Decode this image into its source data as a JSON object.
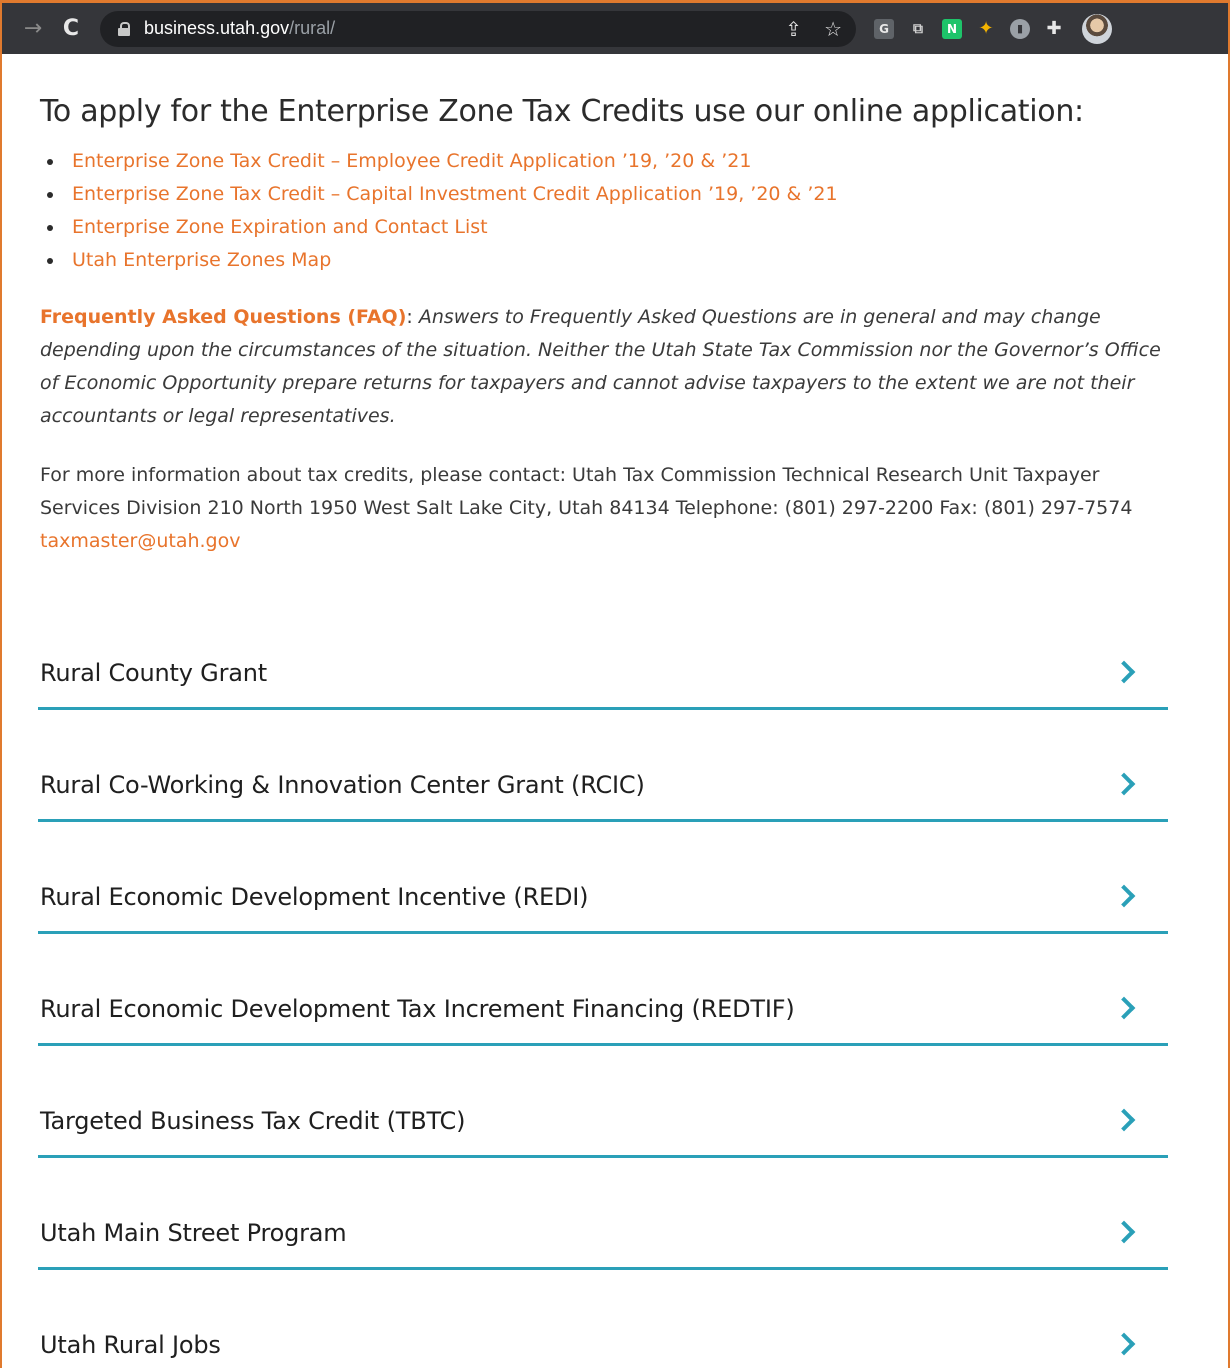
{
  "browser": {
    "url_host": "business.utah.gov",
    "url_path": "/rural/"
  },
  "page": {
    "apply_title": "To apply for the Enterprise Zone Tax Credits use our online application:",
    "links": [
      {
        "label": "Enterprise Zone Tax Credit – Employee Credit Application ’19, ’20 & ’21"
      },
      {
        "label": "Enterprise Zone Tax Credit – Capital Investment Credit Application ’19, ’20 & ’21"
      },
      {
        "label": "Enterprise Zone Expiration and Contact List"
      },
      {
        "label": "Utah Enterprise Zones Map"
      }
    ],
    "faq": {
      "label": "Frequently Asked Questions (FAQ)",
      "separator": ": ",
      "text": "Answers to Frequently Asked Questions are in general and may change depending upon the circumstances of the situation. Neither the Utah State Tax Commission nor the Governor’s Office of Economic Opportunity prepare returns for taxpayers and cannot advise taxpayers to the extent we are not their accountants or legal representatives."
    },
    "contact": {
      "text": "For more information about tax credits, please contact: Utah Tax Commission Technical Research Unit Taxpayer Services Division 210 North 1950 West Salt Lake City, Utah 84134 Telephone: (801) 297-2200 Fax: (801) 297-7574 ",
      "email": "taxmaster@utah.gov"
    },
    "accordion": [
      {
        "label": "Rural County Grant"
      },
      {
        "label": "Rural Co-Working & Innovation Center Grant (RCIC)"
      },
      {
        "label": "Rural Economic Development Incentive (REDI)"
      },
      {
        "label": "Rural Economic Development Tax Increment Financing (REDTIF)"
      },
      {
        "label": "Targeted Business Tax Credit (TBTC)"
      },
      {
        "label": "Utah Main Street Program"
      },
      {
        "label": "Utah Rural Jobs"
      }
    ]
  },
  "colors": {
    "accent_orange": "#e8742c",
    "accent_teal": "#2aa0b8",
    "chrome_bg": "#35363a"
  }
}
